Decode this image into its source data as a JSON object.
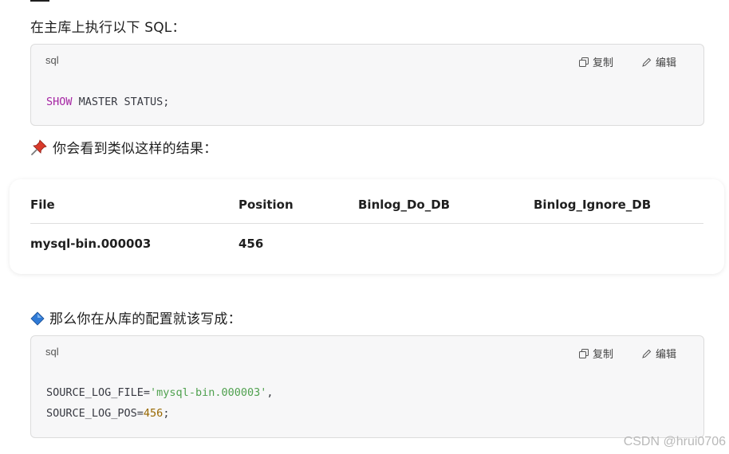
{
  "intro_text": "在主库上执行以下 SQL：",
  "code_block_1": {
    "language": "sql",
    "copy_label": "复制",
    "edit_label": "编辑",
    "line1_keyword": "SHOW",
    "line1_rest": " MASTER STATUS;"
  },
  "result_text": "你会看到类似这样的结果：",
  "result_icon": "pushpin-icon",
  "table": {
    "headers": [
      "File",
      "Position",
      "Binlog_Do_DB",
      "Binlog_Ignore_DB"
    ],
    "rows": [
      [
        "mysql-bin.000003",
        "456",
        "",
        ""
      ]
    ]
  },
  "slave_text": "那么你在从库的配置就该写成：",
  "slave_icon": "blue-diamond-icon",
  "code_block_2": {
    "language": "sql",
    "copy_label": "复制",
    "edit_label": "编辑",
    "line1_key": "SOURCE_LOG_FILE=",
    "line1_value": "'mysql-bin.000003'",
    "line1_end": ",",
    "line2_key": "SOURCE_LOG_POS=",
    "line2_value": "456",
    "line2_end": ";"
  },
  "watermark": "CSDN @hrui0706"
}
